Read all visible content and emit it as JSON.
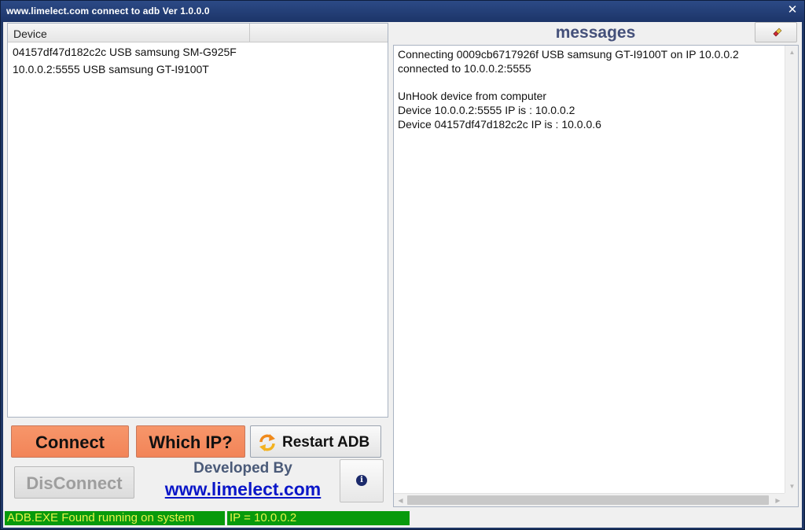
{
  "window": {
    "title": "www.limelect.com  connect to adb  Ver 1.0.0.0",
    "close_glyph": "✕"
  },
  "device_list": {
    "column_header": "Device",
    "rows": [
      "04157df47d182c2c USB samsung  SM-G925F",
      "10.0.0.2:5555 USB samsung  GT-I9100T"
    ]
  },
  "buttons": {
    "connect": "Connect",
    "which_ip": "Which IP?",
    "restart_adb": "Restart ADB",
    "restart_icon": "refresh-arrows-icon",
    "disconnect": "DisConnect",
    "info_icon": "info-icon",
    "info_glyph": "i",
    "clear_icon": "eraser-icon"
  },
  "developer": {
    "label": "Developed By",
    "link": "www.limelect.com"
  },
  "messages": {
    "title": "messages",
    "lines": [
      "Connecting 0009cb6717926f USB samsung  GT-I9100T on IP 10.0.0.2",
      "connected to 10.0.0.2:5555",
      "",
      "UnHook device from computer",
      "Device 10.0.0.2:5555 IP is : 10.0.0.2",
      "Device 04157df47d182c2c IP is : 10.0.0.6"
    ]
  },
  "status": {
    "adb": "ADB.EXE Found running on system",
    "ip": "IP = 10.0.0.2"
  },
  "colors": {
    "title_bar": "#1f3766",
    "action_button": "#f28458",
    "status_bg": "#079a0c",
    "status_text": "#e7f24a",
    "link": "#0a16c8"
  }
}
